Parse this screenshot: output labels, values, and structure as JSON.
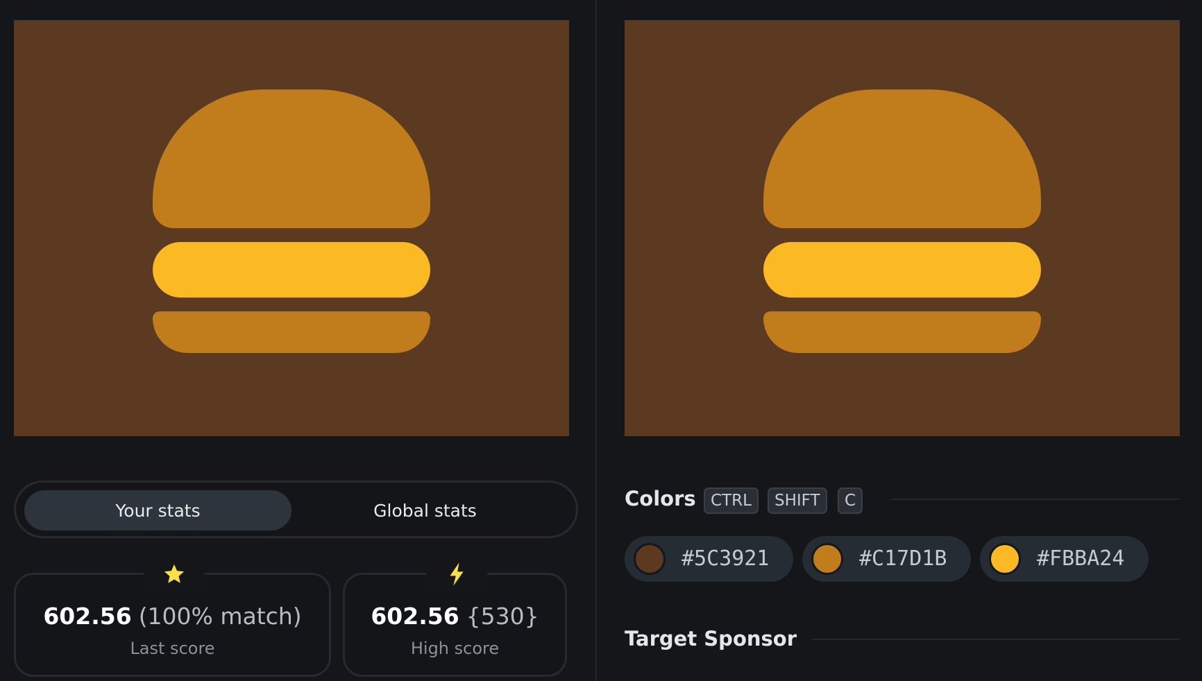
{
  "colors_used": {
    "background": "#5C3921",
    "bun": "#C17D1B",
    "patty": "#FBBA24",
    "page_bg": "#14161a"
  },
  "stats_tabs": {
    "active": "Your stats",
    "inactive": "Global stats"
  },
  "last_score": {
    "value": "602.56",
    "extra": "(100% match)",
    "label": "Last score",
    "icon": "star-icon"
  },
  "high_score": {
    "value": "602.56",
    "extra": "{530}",
    "label": "High score",
    "icon": "lightning-icon"
  },
  "colors_section": {
    "title": "Colors",
    "shortcut_keys": [
      "CTRL",
      "SHIFT",
      "C"
    ],
    "swatches": [
      {
        "hex": "#5C3921",
        "color": "#5C3921"
      },
      {
        "hex": "#C17D1B",
        "color": "#C17D1B"
      },
      {
        "hex": "#FBBA24",
        "color": "#FBBA24"
      }
    ]
  },
  "sponsor_section": {
    "title": "Target Sponsor"
  }
}
